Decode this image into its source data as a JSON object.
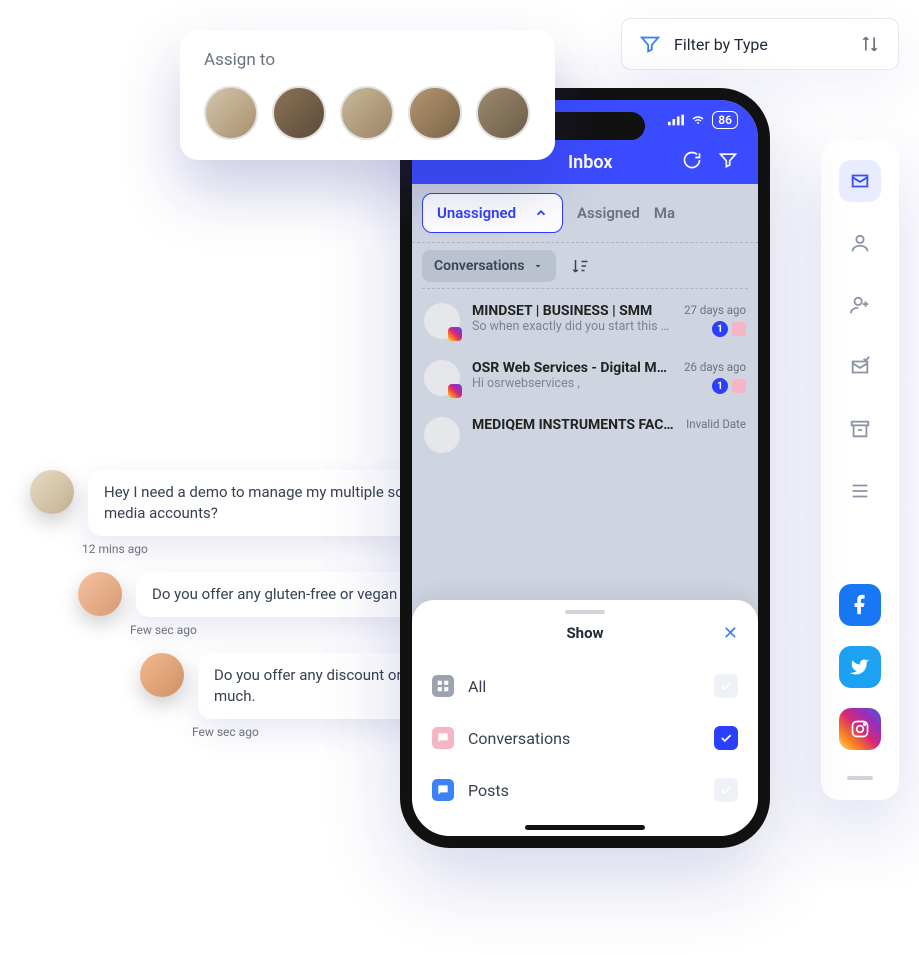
{
  "filter_card": {
    "label": "Filter by Type"
  },
  "assign_card": {
    "title": "Assign to",
    "avatar_count": 5
  },
  "phone": {
    "status": {
      "battery": "86"
    },
    "header": {
      "title": "Inbox"
    },
    "tabs": {
      "active": "Unassigned",
      "t1": "Assigned",
      "t2": "Ma"
    },
    "conv_pill": "Conversations",
    "items": [
      {
        "title": "MINDSET | BUSINESS | SMM",
        "sub": "So when exactly did you start this profil..",
        "time": "27 days ago",
        "count": "1"
      },
      {
        "title": "OSR Web Services - Digital Mar...",
        "sub": "Hi osrwebservices ,",
        "time": "26 days ago",
        "count": "1"
      },
      {
        "title": "MEDIQEM INSTRUMENTS FACTORY",
        "sub": "",
        "time": "Invalid Date",
        "count": ""
      }
    ],
    "sheet": {
      "title": "Show",
      "options": [
        {
          "label": "All",
          "checked": false
        },
        {
          "label": "Conversations",
          "checked": true
        },
        {
          "label": "Posts",
          "checked": false
        }
      ]
    }
  },
  "rail": {
    "icons": [
      "mail-icon",
      "user-icon",
      "user-add-icon",
      "check-mail-icon",
      "archive-icon",
      "menu-icon"
    ]
  },
  "chats": [
    {
      "text": "Hey I need a demo to manage my multiple social media accounts?",
      "time": "12 mins ago"
    },
    {
      "text": "Do you offer any gluten-free or vegan menu?",
      "time": "Few sec ago"
    },
    {
      "text": "Do you offer any discount on how much.",
      "time": "Few sec ago"
    }
  ]
}
